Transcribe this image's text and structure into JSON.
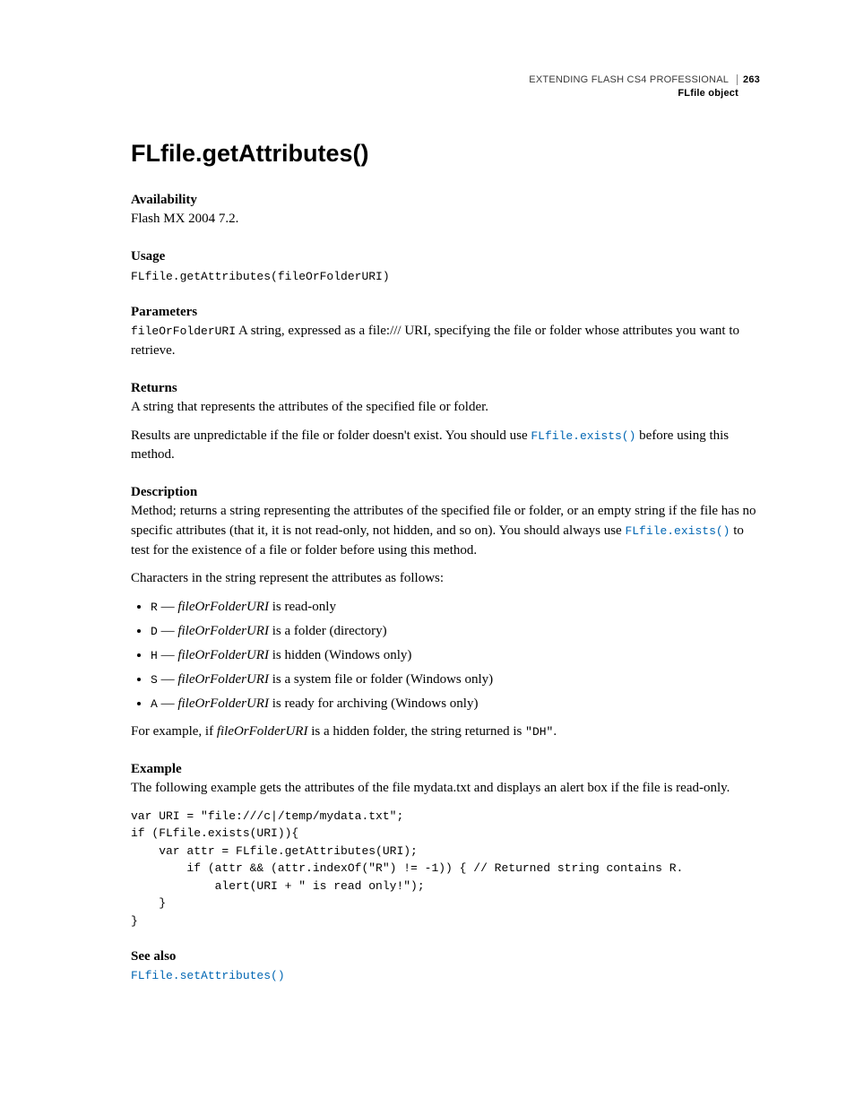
{
  "header": {
    "book_title": "EXTENDING FLASH CS4 PROFESSIONAL",
    "page_number": "263",
    "section_name": "FLfile object"
  },
  "title": "FLfile.getAttributes()",
  "availability": {
    "heading": "Availability",
    "text": "Flash MX 2004 7.2."
  },
  "usage": {
    "heading": "Usage",
    "code": "FLfile.getAttributes(fileOrFolderURI)"
  },
  "parameters": {
    "heading": "Parameters",
    "name": "fileOrFolderURI",
    "desc": "  A string, expressed as a file:/// URI, specifying the file or folder whose attributes you want to retrieve."
  },
  "returns": {
    "heading": "Returns",
    "p1": "A string that represents the attributes of the specified file or folder.",
    "p2_a": "Results are unpredictable if the file or folder doesn't exist. You should use ",
    "p2_link": "FLfile.exists()",
    "p2_b": " before using this method."
  },
  "description": {
    "heading": "Description",
    "p1_a": "Method; returns a string representing the attributes of the specified file or folder, or an empty string if the file has no specific attributes (that it, it is not read-only, not hidden, and so on). You should always use ",
    "p1_link": "FLfile.exists()",
    "p1_b": " to test for the existence of a file or folder before using this method.",
    "p2": "Characters in the string represent the attributes as follows:",
    "items": [
      {
        "code": "R",
        "em": "fileOrFolderURI",
        "tail": " is read-only"
      },
      {
        "code": "D",
        "em": "fileOrFolderURI",
        "tail": " is a folder (directory)"
      },
      {
        "code": "H",
        "em": "fileOrFolderURI",
        "tail": " is hidden (Windows only)"
      },
      {
        "code": "S",
        "em": "fileOrFolderURI",
        "tail": " is a system file or folder (Windows only)"
      },
      {
        "code": "A",
        "em": "fileOrFolderURI",
        "tail": " is ready for archiving (Windows only)"
      }
    ],
    "p3_a": "For example, if ",
    "p3_em": "fileOrFolderURI",
    "p3_b": " is a hidden folder, the string returned is ",
    "p3_code": "\"DH\"",
    "p3_c": "."
  },
  "example": {
    "heading": "Example",
    "intro": "The following example gets the attributes of the file mydata.txt and displays an alert box if the file is read-only.",
    "code": "var URI = \"file:///c|/temp/mydata.txt\";\nif (FLfile.exists(URI)){\n    var attr = FLfile.getAttributes(URI);\n        if (attr && (attr.indexOf(\"R\") != -1)) { // Returned string contains R.\n            alert(URI + \" is read only!\");\n    }\n}"
  },
  "see_also": {
    "heading": "See also",
    "link": "FLfile.setAttributes()"
  }
}
